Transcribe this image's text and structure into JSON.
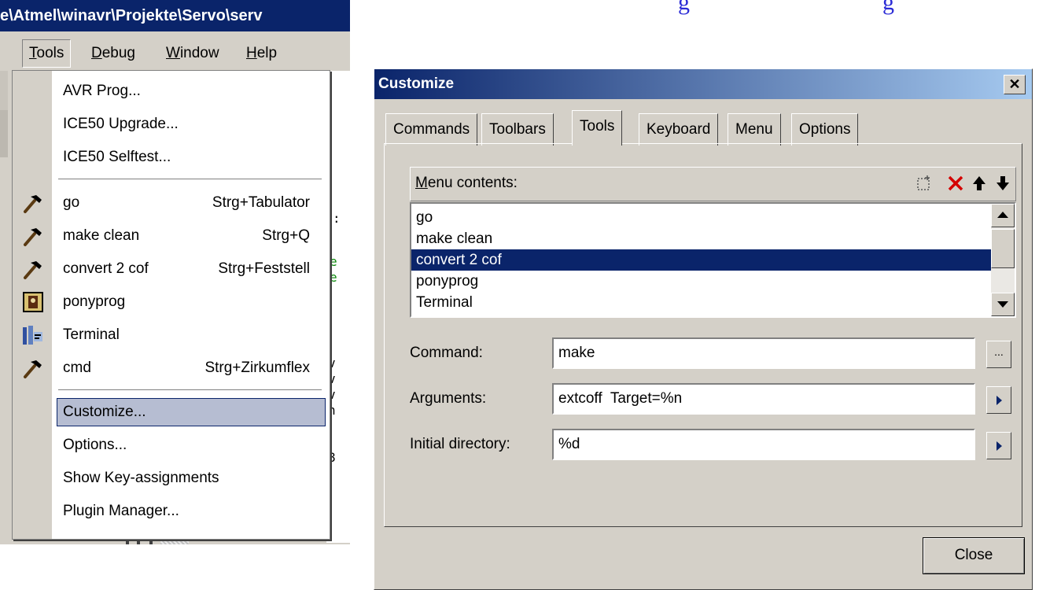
{
  "link_fragment": "...g...g",
  "ide": {
    "title": "e\\Atmel\\winavr\\Projekte\\Servo\\serv",
    "menubar": [
      {
        "label": "Tools",
        "mnemonic": "T"
      },
      {
        "label": "Debug",
        "mnemonic": "D"
      },
      {
        "label": "Window",
        "mnemonic": "W"
      },
      {
        "label": "Help",
        "mnemonic": "H"
      }
    ],
    "code_glyphs": [
      ":",
      "e",
      "e",
      "v",
      "v",
      "v",
      "n",
      "8"
    ]
  },
  "tools_menu": {
    "items": [
      {
        "label": "AVR Prog...",
        "shortcut": "",
        "icon": ""
      },
      {
        "label": "ICE50 Upgrade...",
        "shortcut": "",
        "icon": ""
      },
      {
        "label": "ICE50 Selftest...",
        "shortcut": "",
        "icon": ""
      },
      {
        "label": "go",
        "shortcut": "Strg+Tabulator",
        "icon": "hammer-icon"
      },
      {
        "label": "make clean",
        "shortcut": "Strg+Q",
        "icon": "hammer-icon"
      },
      {
        "label": "convert 2 cof",
        "shortcut": "Strg+Feststell",
        "icon": "hammer-icon"
      },
      {
        "label": "ponyprog",
        "shortcut": "",
        "icon": "ponyprog-icon"
      },
      {
        "label": "Terminal",
        "shortcut": "",
        "icon": "terminal-icon"
      },
      {
        "label": "cmd",
        "shortcut": "Strg+Zirkumflex",
        "icon": "hammer-icon"
      },
      {
        "label": "Customize...",
        "shortcut": "",
        "icon": "",
        "highlighted": true
      },
      {
        "label": "Options...",
        "shortcut": "",
        "icon": ""
      },
      {
        "label": "Show Key-assignments",
        "shortcut": "",
        "icon": ""
      },
      {
        "label": "Plugin Manager...",
        "shortcut": "",
        "icon": ""
      }
    ]
  },
  "dialog": {
    "title": "Customize",
    "close_glyph": "✕",
    "tabs": [
      "Commands",
      "Toolbars",
      "Tools",
      "Keyboard",
      "Menu",
      "Options"
    ],
    "active_tab": "Tools",
    "menu_contents_label": "Menu contents:",
    "header_icons": [
      "new-item-icon",
      "delete-icon",
      "move-up-icon",
      "move-down-icon"
    ],
    "menu_contents": [
      "go",
      "make clean",
      "convert 2 cof",
      "ponyprog",
      "Terminal"
    ],
    "selected_index": 2,
    "command_label": "Command:",
    "command_value": "make",
    "browse_label": "...",
    "arguments_label": "Arguments:",
    "arguments_value": "extcoff  Target=%n",
    "initial_dir_label": "Initial directory:",
    "initial_dir_value": "%d",
    "close_button": "Close"
  },
  "colors": {
    "title_blue": "#0a246a",
    "face": "#d4d0c8",
    "menu_highlight": "#b6bdd2",
    "delete_red": "#d40000"
  }
}
